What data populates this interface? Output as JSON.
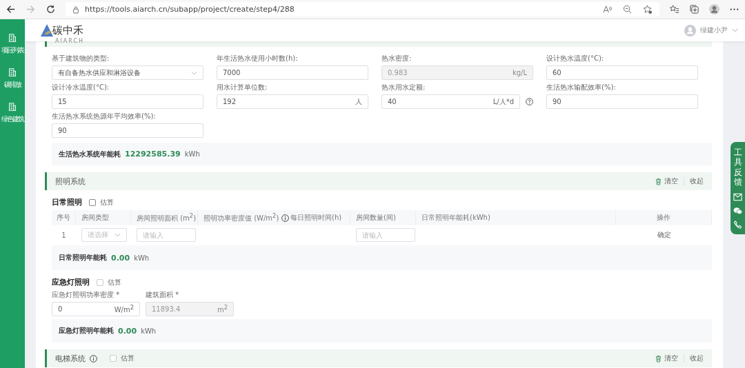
{
  "browser": {
    "url": "https://tools.aiarch.cn/subapp/project/create/step4/288"
  },
  "header": {
    "logo_text": "碳中禾",
    "logo_sub": "AIARCH",
    "user": "绿建小尹"
  },
  "sidebar": {
    "items": [
      {
        "label": "项目列表"
      },
      {
        "label": "碳排放"
      },
      {
        "label": "绿色建筑"
      }
    ]
  },
  "hot_water": {
    "fields": [
      {
        "kind": "select",
        "label": "基于建筑物的类型:",
        "value": "有自备热水供应和淋浴设备",
        "disabled": false
      },
      {
        "kind": "input",
        "label": "年生活热水使用小时数(h):",
        "value": "7000",
        "disabled": false
      },
      {
        "kind": "input",
        "label": "热水密度:",
        "value": "0.983",
        "unit": "kg/L",
        "disabled": true
      },
      {
        "kind": "input",
        "label": "设计热水温度(°C):",
        "value": "60",
        "disabled": false
      },
      {
        "kind": "input",
        "label": "设计冷水温度(°C):",
        "value": "15",
        "disabled": false
      },
      {
        "kind": "input",
        "label": "用水计算单位数:",
        "value": "192",
        "unit": "人",
        "disabled": false
      },
      {
        "kind": "input",
        "label": "热水用水定额:",
        "value": "40",
        "unit": "L/人*d",
        "disabled": false,
        "help": true
      },
      {
        "kind": "input",
        "label": "生活热水输配效率(%):",
        "value": "90",
        "disabled": false
      },
      {
        "kind": "input",
        "label": "生活热水系统热源年平均效率(%):",
        "value": "90",
        "disabled": false
      }
    ],
    "summary": {
      "label": "生活热水系统年能耗",
      "value": "12292585.39",
      "unit": "kWh"
    }
  },
  "lighting": {
    "title": "照明系统",
    "actions": [
      "清空",
      "收起"
    ],
    "daily": {
      "title": "日常照明",
      "estimate": {
        "label": "估算",
        "checked": false
      },
      "columns": [
        {
          "label": "序号"
        },
        {
          "label": "房间类型"
        },
        {
          "label": "房间照明面积 (m$^{2}$)"
        },
        {
          "label": "照明功率密度值 (W/m$^{2}$)",
          "info": true
        },
        {
          "label": "每日照明时间(h)"
        },
        {
          "label": "房间数量(间)"
        },
        {
          "label": "日常照明年能耗(kWh)"
        },
        {
          "label": "操作"
        }
      ],
      "rows": [
        {
          "index": "1",
          "room_type": {
            "placeholder": "请选择"
          },
          "area": {
            "placeholder": "请输入"
          },
          "count": {
            "placeholder": "请输入"
          },
          "action": "确定"
        }
      ],
      "summary": {
        "label": "日常照明年能耗",
        "value": "0.00",
        "unit": "kWh"
      }
    },
    "emergency": {
      "title": "应急灯照明",
      "estimate": {
        "label": "估算",
        "checked": false
      },
      "fields": [
        {
          "label": "应急灯照明功率密度 *",
          "value": "0",
          "unit": "W/m$^{2}$",
          "disabled": false
        },
        {
          "label": "建筑面积 *",
          "value": "11893.4",
          "unit": "m$^{2}$",
          "disabled": true
        }
      ],
      "summary": {
        "label": "应急灯照明年能耗",
        "value": "0.00",
        "unit": "kWh"
      }
    }
  },
  "elevator": {
    "title": "电梯系统",
    "estimate": {
      "label": "估算",
      "checked": false
    },
    "actions": [
      "清空",
      "收起"
    ]
  },
  "float_panel": {
    "label": "工具反馈"
  }
}
